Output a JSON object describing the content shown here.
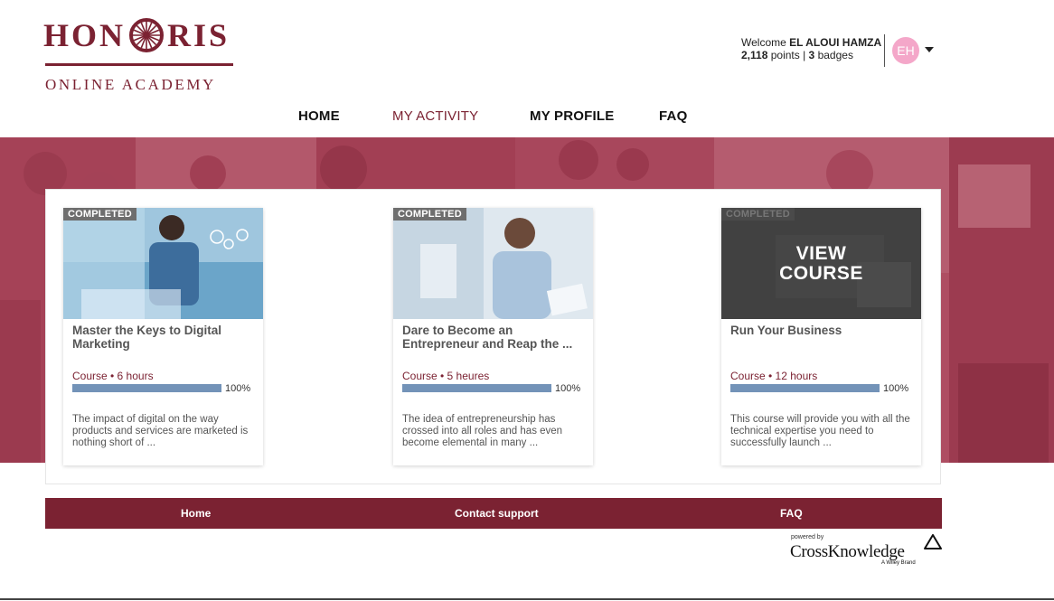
{
  "brand": {
    "logo_left": "HON",
    "logo_right": "RIS",
    "logo_subtitle": "ONLINE ACADEMY",
    "color": "#7b2232"
  },
  "user": {
    "welcome": "Welcome",
    "name": "EL ALOUI HAMZA",
    "points": "2,118",
    "points_label": "points |",
    "badges": "3",
    "badges_label": "badges",
    "initials": "EH",
    "avatar_color": "#f4a7c9"
  },
  "nav": {
    "home": "HOME",
    "activity": "MY ACTIVITY",
    "profile": "MY PROFILE",
    "faq": "FAQ",
    "active": "MY ACTIVITY"
  },
  "courses": [
    {
      "status": "COMPLETED",
      "title": "Master the Keys to Digital Marketing",
      "meta": "Course • 6 hours",
      "progress": 100,
      "progress_label": "100%",
      "description": "The impact of digital on the way products and services are marketed is nothing short of ..."
    },
    {
      "status": "COMPLETED",
      "title": "Dare to Become an Entrepreneur and Reap the ...",
      "meta": "Course • 5 heures",
      "progress": 100,
      "progress_label": "100%",
      "description": "The idea of entrepreneurship has crossed into all roles and has even become elemental in many ..."
    },
    {
      "status": "COMPLETED",
      "title": "Run Your Business",
      "meta": "Course • 12 hours",
      "progress": 100,
      "progress_label": "100%",
      "description": "This course will provide you with all the technical expertise you need to successfully launch ...",
      "hover_label_1": "VIEW",
      "hover_label_2": "COURSE"
    }
  ],
  "footer": {
    "home": "Home",
    "support": "Contact support",
    "faq": "FAQ",
    "powered_by": "powered by",
    "provider": "CrossKnowledge",
    "provider_sub": "A Wiley Brand"
  }
}
